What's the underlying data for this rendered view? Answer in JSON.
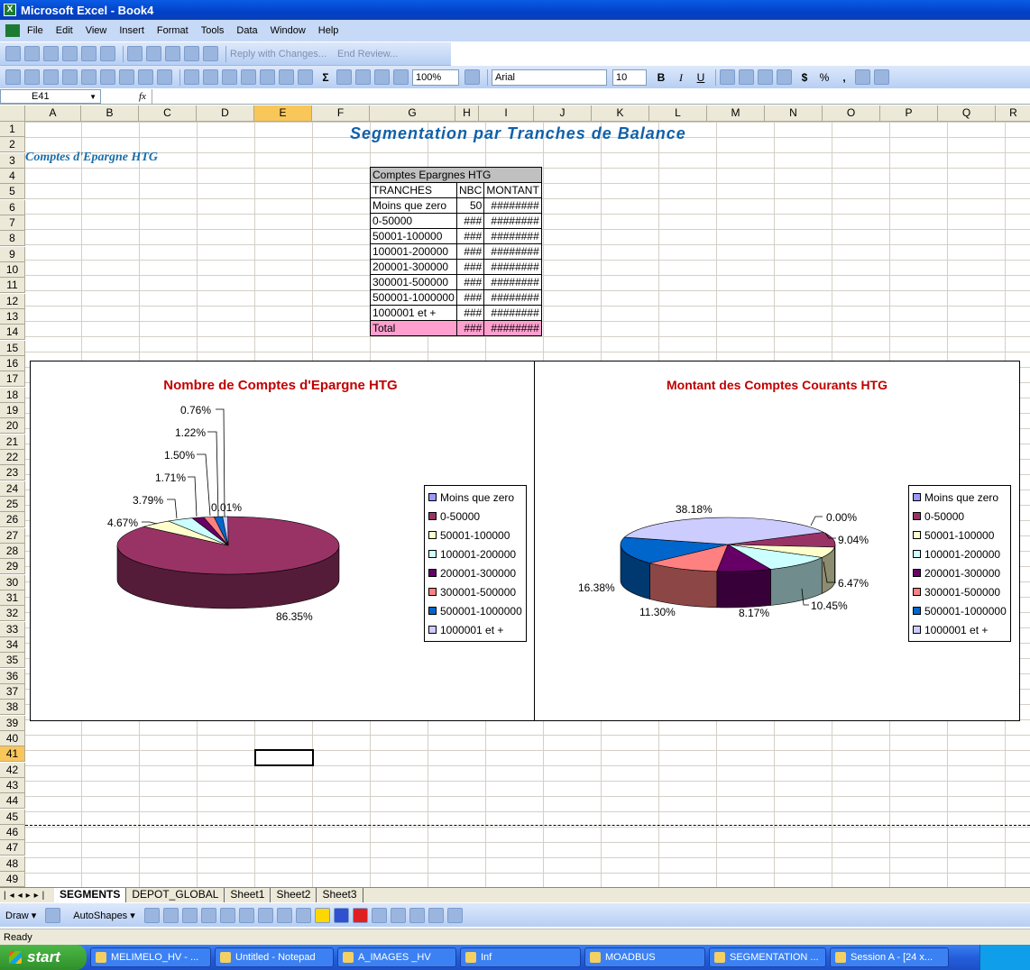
{
  "window": {
    "title": "Microsoft Excel - Book4"
  },
  "menu": [
    "File",
    "Edit",
    "View",
    "Insert",
    "Format",
    "Tools",
    "Data",
    "Window",
    "Help"
  ],
  "review_toolbar": {
    "reply": "Reply with Changes...",
    "end_review": "End Review..."
  },
  "standard_toolbar": {
    "zoom": "100%",
    "font": "Arial",
    "size": "10",
    "sigma": "Σ"
  },
  "format_buttons": [
    "B",
    "I",
    "U",
    "$",
    "%",
    ","
  ],
  "formula_bar": {
    "cell_ref": "E41",
    "fx": "fx"
  },
  "columns": [
    "A",
    "B",
    "C",
    "D",
    "E",
    "F",
    "G",
    "H",
    "I",
    "J",
    "K",
    "L",
    "M",
    "N",
    "O",
    "P",
    "Q",
    "R"
  ],
  "rows": [
    "1",
    "2",
    "3",
    "4",
    "5",
    "6",
    "7",
    "8",
    "9",
    "10",
    "11",
    "12",
    "13",
    "14",
    "15",
    "16",
    "17",
    "18",
    "19",
    "20",
    "21",
    "22",
    "23",
    "24",
    "25",
    "26",
    "27",
    "28",
    "29",
    "30",
    "31",
    "32",
    "33",
    "34",
    "35",
    "36",
    "37",
    "38",
    "39",
    "40",
    "41",
    "42",
    "43",
    "44",
    "45",
    "46",
    "47",
    "48",
    "49"
  ],
  "sheet": {
    "title": "Segmentation  par Tranches de Balance",
    "subtitle": "Comptes d'Epargne HTG",
    "table": {
      "caption": "Comptes Epargnes HTG",
      "headers": [
        "TRANCHES",
        "NBC",
        "MONTANT"
      ],
      "rows": [
        [
          "Moins que zero",
          "50",
          "########"
        ],
        [
          "0-50000",
          "###",
          "########"
        ],
        [
          "50001-100000",
          "###",
          "########"
        ],
        [
          "100001-200000",
          "###",
          "########"
        ],
        [
          "200001-300000",
          "###",
          "########"
        ],
        [
          "300001-500000",
          "###",
          "########"
        ],
        [
          "500001-1000000",
          "###",
          "########"
        ],
        [
          "1000001 et +",
          "###",
          "########"
        ]
      ],
      "total": [
        "Total",
        "###",
        "########"
      ]
    }
  },
  "chart_data": [
    {
      "type": "pie",
      "title": "Nombre de Comptes d'Epargne HTG",
      "categories": [
        "Moins que zero",
        "0-50000",
        "50001-100000",
        "100001-200000",
        "200001-300000",
        "300001-500000",
        "500001-1000000",
        "1000001 et +"
      ],
      "values": [
        0.01,
        86.35,
        4.67,
        3.79,
        1.71,
        1.5,
        1.22,
        0.76
      ],
      "labels": [
        "0.01%",
        "86.35%",
        "4.67%",
        "3.79%",
        "1.71%",
        "1.50%",
        "1.22%",
        "0.76%"
      ],
      "colors": [
        "#9999ff",
        "#993366",
        "#ffffcc",
        "#ccffff",
        "#660066",
        "#ff8080",
        "#0066cc",
        "#ccccff"
      ],
      "legend": "right"
    },
    {
      "type": "pie",
      "title": "Montant des Comptes Courants HTG",
      "categories": [
        "Moins que zero",
        "0-50000",
        "50001-100000",
        "100001-200000",
        "200001-300000",
        "300001-500000",
        "500001-1000000",
        "1000001 et +"
      ],
      "values": [
        0.0,
        9.04,
        6.47,
        10.45,
        8.17,
        11.3,
        16.38,
        38.18
      ],
      "labels": [
        "0.00%",
        "9.04%",
        "6.47%",
        "10.45%",
        "8.17%",
        "11.30%",
        "16.38%",
        "38.18%"
      ],
      "colors": [
        "#9999ff",
        "#993366",
        "#ffffcc",
        "#ccffff",
        "#660066",
        "#ff8080",
        "#0066cc",
        "#ccccff"
      ],
      "legend": "right"
    }
  ],
  "sheet_tabs": [
    "SEGMENTS",
    "DEPOT_GLOBAL",
    "Sheet1",
    "Sheet2",
    "Sheet3"
  ],
  "draw_toolbar": {
    "draw": "Draw ▾",
    "autoshapes": "AutoShapes ▾"
  },
  "status": "Ready",
  "taskbar": {
    "start": "start",
    "tasks": [
      "MELIMELO_HV - ...",
      "Untitled - Notepad",
      "A_IMAGES _HV",
      "Inf",
      "MOADBUS",
      "SEGMENTATION ...",
      "Session A - [24 x..."
    ]
  }
}
